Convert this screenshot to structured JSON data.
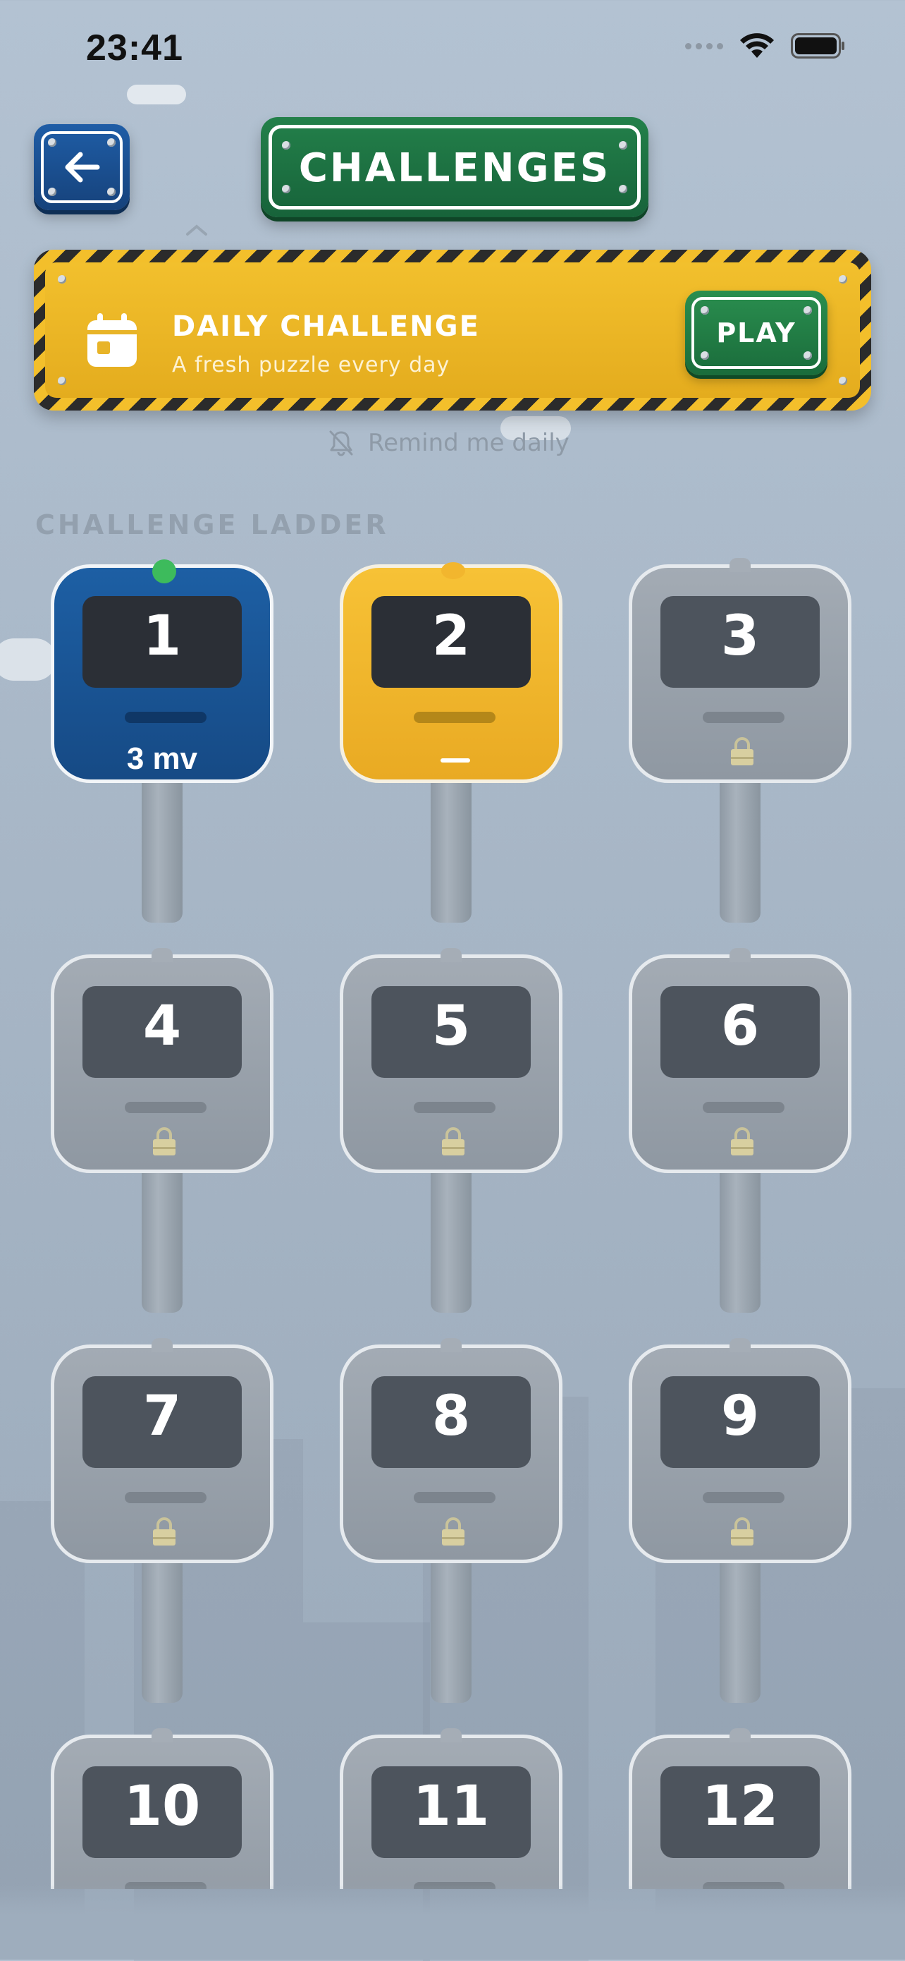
{
  "status_bar": {
    "time": "23:41"
  },
  "header": {
    "title": "CHALLENGES"
  },
  "daily_challenge": {
    "title": "DAILY CHALLENGE",
    "subtitle": "A fresh puzzle every day",
    "play_label": "PLAY"
  },
  "reminder": {
    "label": "Remind me daily"
  },
  "ladder": {
    "heading": "CHALLENGE LADDER",
    "levels": [
      {
        "number": "1",
        "state": "complete",
        "result": "3 mv"
      },
      {
        "number": "2",
        "state": "current",
        "result": "—"
      },
      {
        "number": "3",
        "state": "locked"
      },
      {
        "number": "4",
        "state": "locked"
      },
      {
        "number": "5",
        "state": "locked"
      },
      {
        "number": "6",
        "state": "locked"
      },
      {
        "number": "7",
        "state": "locked"
      },
      {
        "number": "8",
        "state": "locked"
      },
      {
        "number": "9",
        "state": "locked"
      },
      {
        "number": "10",
        "state": "locked"
      },
      {
        "number": "11",
        "state": "locked"
      },
      {
        "number": "12",
        "state": "locked"
      }
    ]
  },
  "colors": {
    "sky": "#aebdcd",
    "complete_tile": "#1d5fa4",
    "current_tile": "#f2b62e",
    "locked_tile": "#99a1ab",
    "sign_green": "#1f7a45",
    "banner_yellow": "#f0bc2b",
    "complete_indicator": "#3dbb5c",
    "current_indicator": "#f2b62e"
  }
}
